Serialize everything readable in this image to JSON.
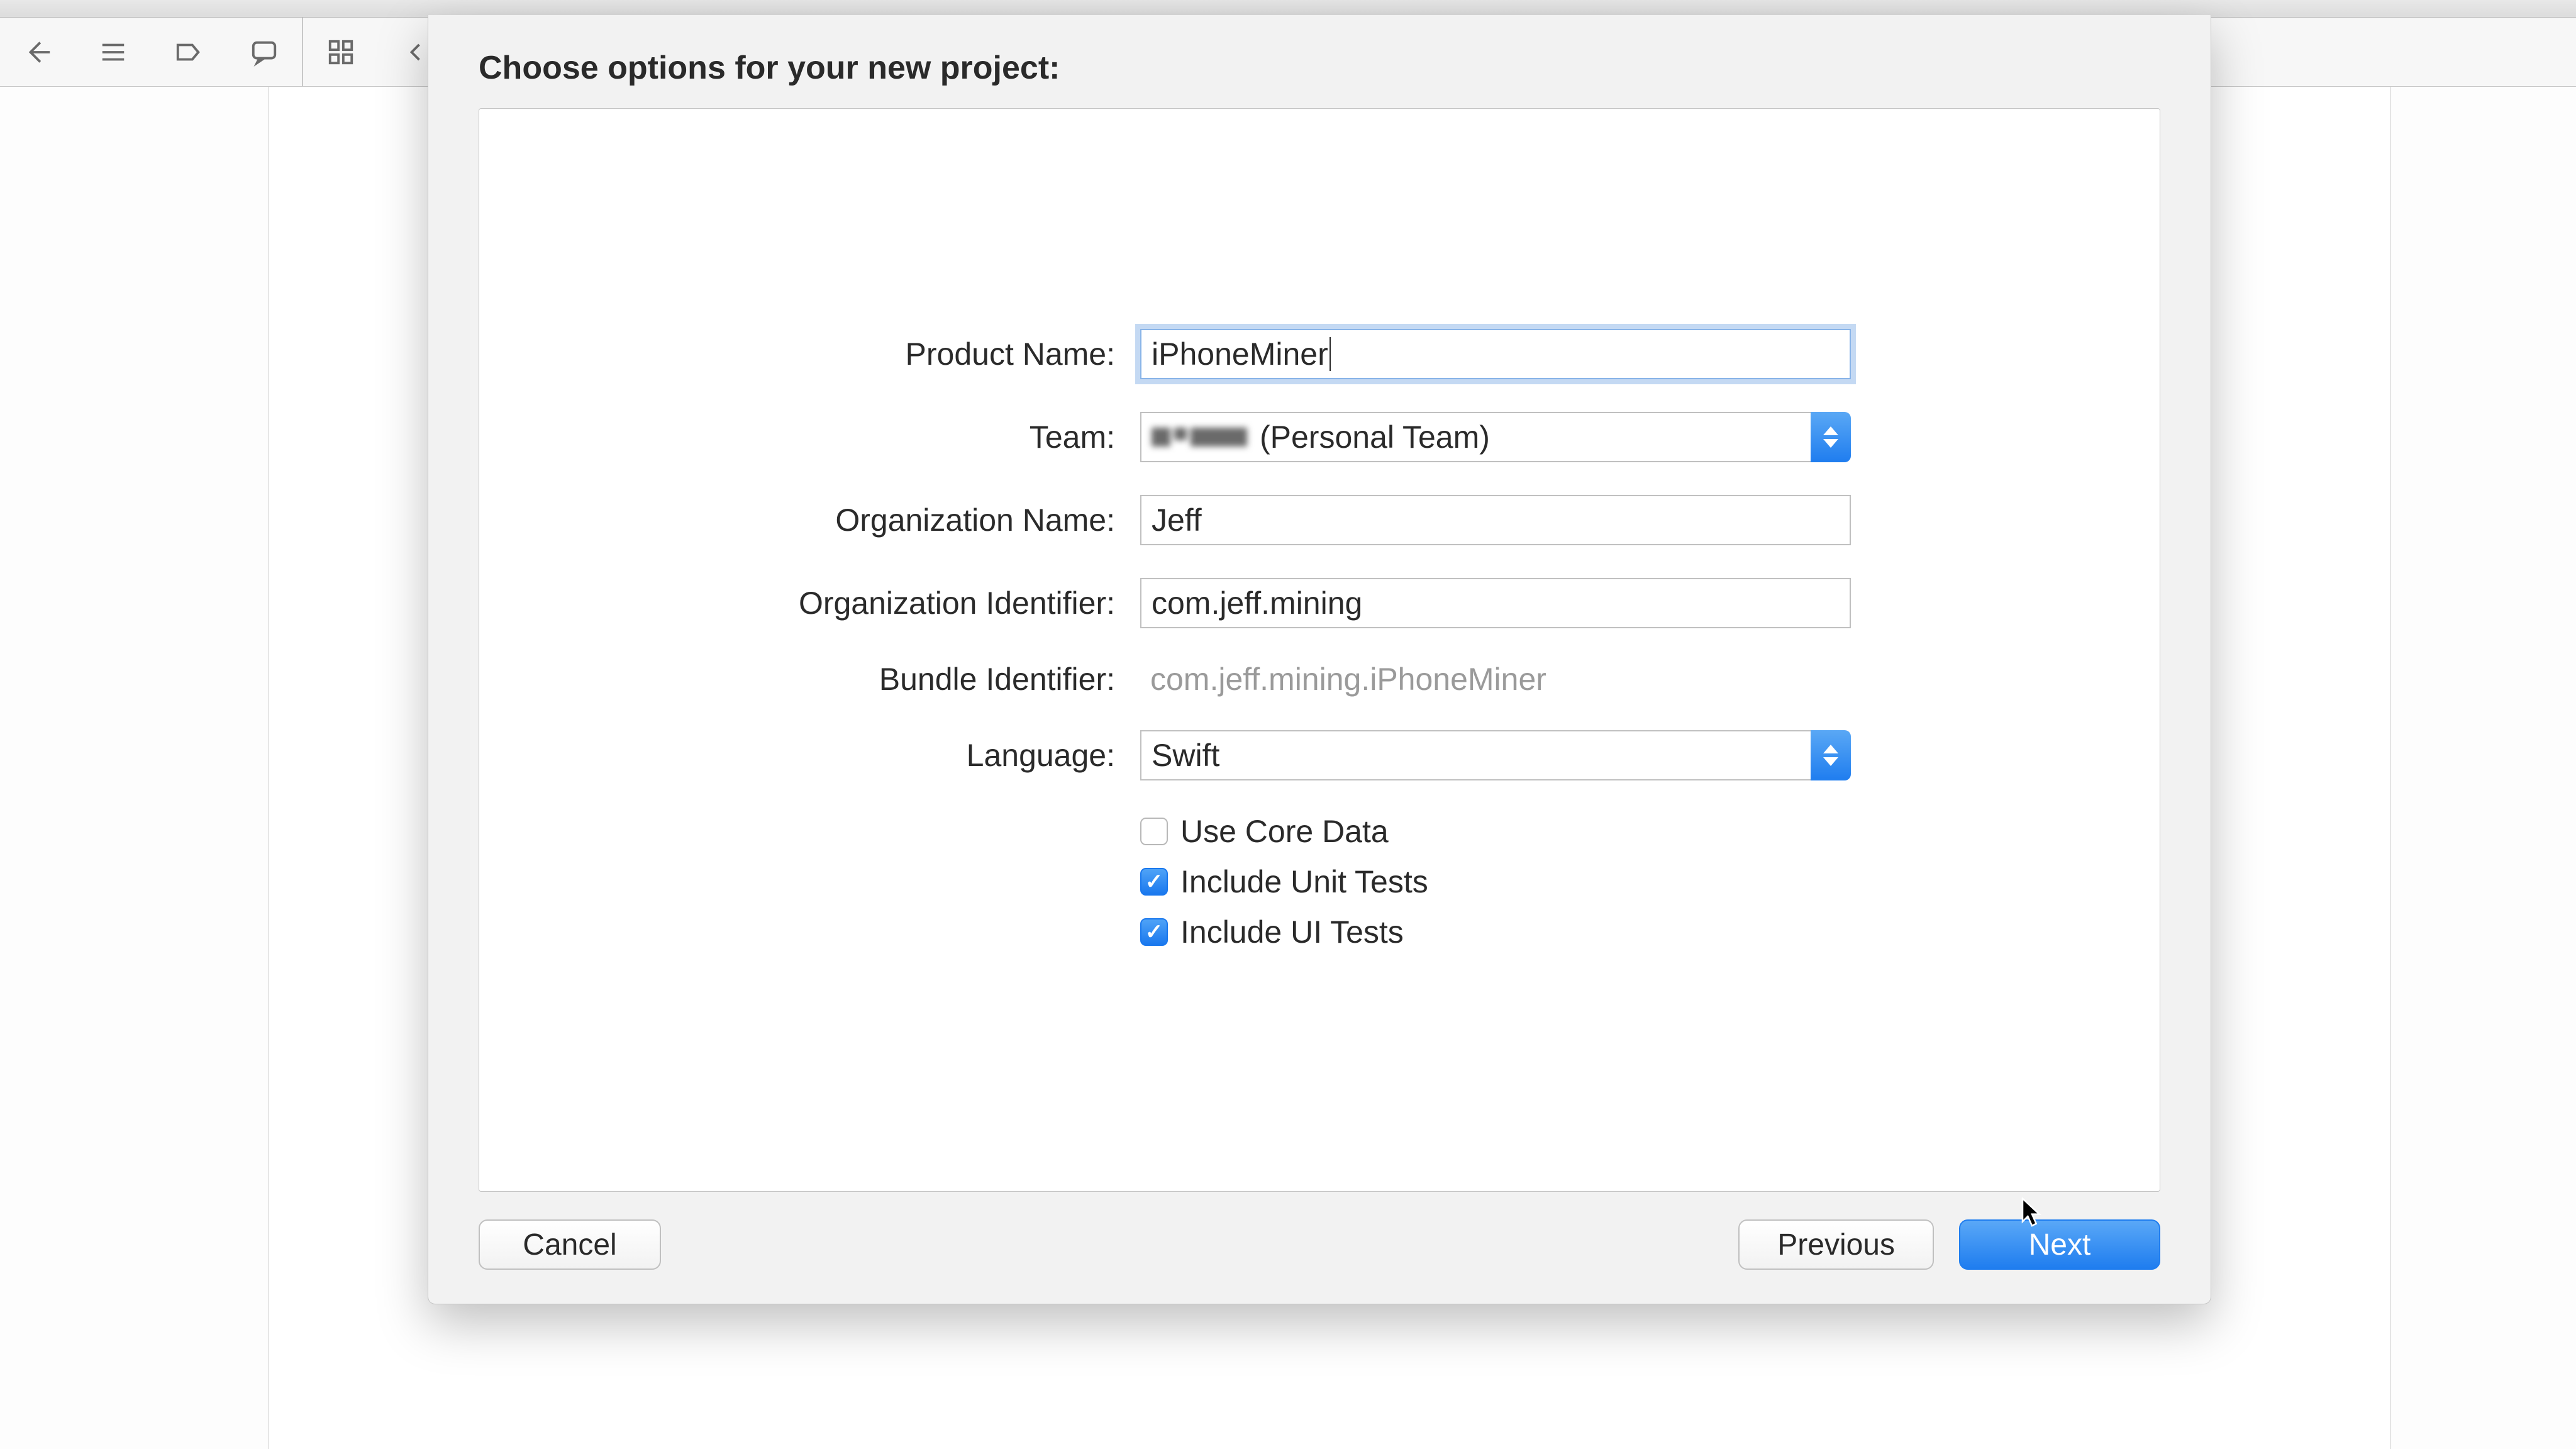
{
  "sheet": {
    "title": "Choose options for your new project:",
    "footer": {
      "cancel": "Cancel",
      "previous": "Previous",
      "next": "Next"
    }
  },
  "form": {
    "productName": {
      "label": "Product Name:",
      "value": "iPhoneMiner"
    },
    "team": {
      "label": "Team:",
      "value": "(Personal Team)"
    },
    "orgName": {
      "label": "Organization Name:",
      "value": "Jeff"
    },
    "orgIdentifier": {
      "label": "Organization Identifier:",
      "value": "com.jeff.mining"
    },
    "bundleIdentifier": {
      "label": "Bundle Identifier:",
      "value": "com.jeff.mining.iPhoneMiner"
    },
    "language": {
      "label": "Language:",
      "value": "Swift"
    },
    "coreData": {
      "label": "Use Core Data",
      "checked": false
    },
    "unitTests": {
      "label": "Include Unit Tests",
      "checked": true
    },
    "uiTests": {
      "label": "Include UI Tests",
      "checked": true
    }
  }
}
